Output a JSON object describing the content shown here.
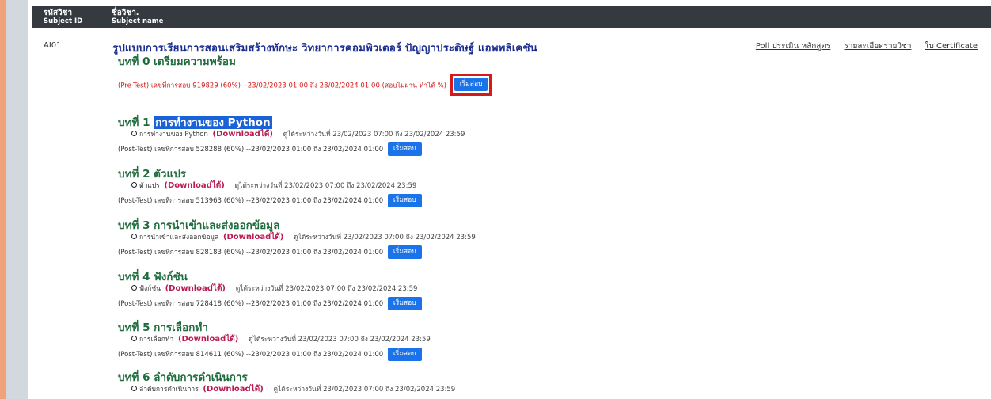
{
  "header": {
    "col_id_th": "รหัสวิชา",
    "col_id_en": "Subject ID",
    "col_name_th": "ชื่อวิชา.",
    "col_name_en": "Subject name"
  },
  "subject": {
    "id": "AI01",
    "title": "รูปแบบการเรียนการสอนเสริมสร้างทักษะ วิทยาการคอมพิวเตอร์ ปัญญาประดิษฐ์ แอพพลิเคชัน",
    "links": [
      "Poll ประเมิน หลักสูตร",
      "รายละเอียดรายวิชา",
      "ใบ Certificate"
    ]
  },
  "start_button_label": "เริ่มสอบ",
  "download_label": "(Downloadได้)",
  "lesson0": {
    "title": "บทที่ 0 เตรียมความพร้อม",
    "test": "(Pre-Test) เลขที่การสอบ 919829 (60%) --23/02/2023 01:00 ถึง 28/02/2024 01:00 (สอบไม่ผ่าน ทำได้ %)"
  },
  "lessons": [
    {
      "prefix": "บทที่ 1",
      "highlight": "การทำงานของ Python",
      "material": "การทำงานของ Python",
      "period": "ดูได้ระหว่างวันที่ 23/02/2023 07:00 ถึง 23/02/2024 23:59",
      "test": "(Post-Test) เลขที่การสอบ 528288 (60%) --23/02/2023 01:00 ถึง 23/02/2024 01:00"
    },
    {
      "title": "บทที่ 2 ตัวแปร",
      "material": "ตัวแปร",
      "period": "ดูได้ระหว่างวันที่ 23/02/2023 07:00 ถึง 23/02/2024 23:59",
      "test": "(Post-Test) เลขที่การสอบ 513963 (60%) --23/02/2023 01:00 ถึง 23/02/2024 01:00"
    },
    {
      "title": "บทที่ 3 การนำเข้าและส่งออกข้อมูล",
      "material": "การนำเข้าและส่งออกข้อมูล",
      "period": "ดูได้ระหว่างวันที่ 23/02/2023 07:00 ถึง 23/02/2024 23:59",
      "test": "(Post-Test) เลขที่การสอบ 828183 (60%) --23/02/2023 01:00 ถึง 23/02/2024 01:00"
    },
    {
      "title": "บทที่ 4 ฟังก์ชัน",
      "material": "ฟังก์ชัน",
      "period": "ดูได้ระหว่างวันที่ 23/02/2023 07:00 ถึง 23/02/2024 23:59",
      "test": "(Post-Test) เลขที่การสอบ 728418 (60%) --23/02/2023 01:00 ถึง 23/02/2024 01:00"
    },
    {
      "title": "บทที่ 5 การเลือกทำ",
      "material": "การเลือกทำ",
      "period": "ดูได้ระหว่างวันที่ 23/02/2023 07:00 ถึง 23/02/2024 23:59",
      "test": "(Post-Test) เลขที่การสอบ 814611 (60%) --23/02/2023 01:00 ถึง 23/02/2024 01:00"
    },
    {
      "title": "บทที่ 6 ลำดับการดำเนินการ",
      "material": "ลำดับการดำเนินการ",
      "period": "ดูได้ระหว่างวันที่ 23/02/2023 07:00 ถึง 23/02/2024 23:59"
    }
  ],
  "colors": {
    "header_bg": "#343a40",
    "subject_title": "#1b2e8f",
    "lesson_title": "#1e6c3d",
    "download": "#b81c52",
    "button": "#1a73e8",
    "pretest_text": "#d31b1b",
    "highlight_box": "#d41b1b",
    "left_accent": "#f0a27a"
  }
}
